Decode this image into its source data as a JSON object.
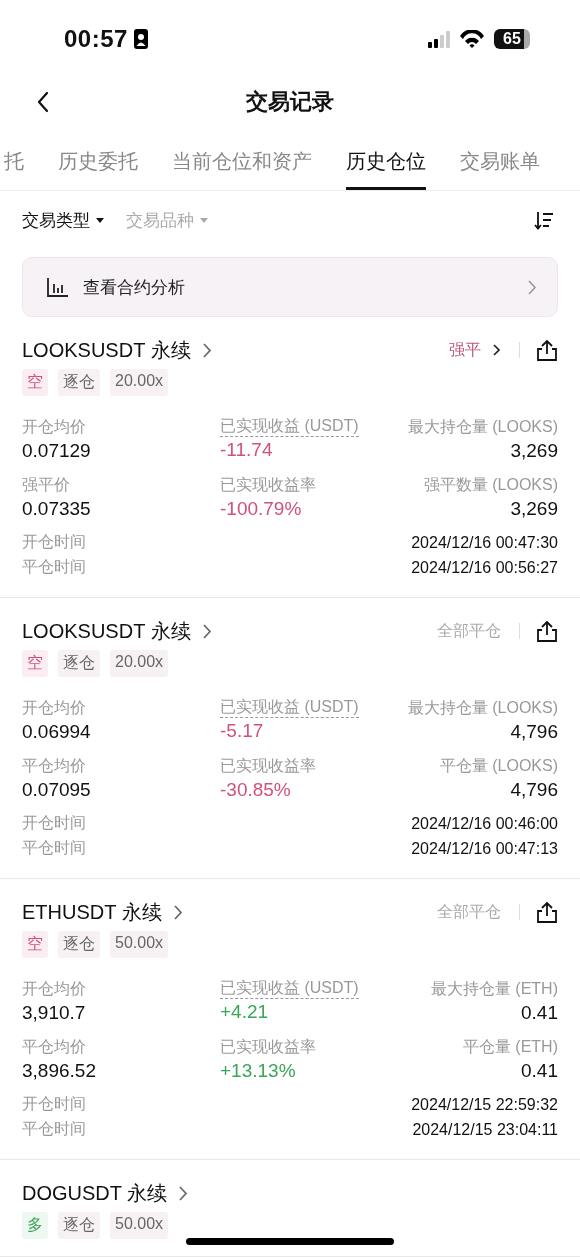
{
  "status_bar": {
    "time": "00:57",
    "battery": "65"
  },
  "nav": {
    "title": "交易记录"
  },
  "tabs": [
    {
      "label": "托",
      "selected": false
    },
    {
      "label": "历史委托",
      "selected": false
    },
    {
      "label": "当前仓位和资产",
      "selected": false
    },
    {
      "label": "历史仓位",
      "selected": true
    },
    {
      "label": "交易账单",
      "selected": false
    }
  ],
  "filters": [
    {
      "label": "交易类型",
      "active": true
    },
    {
      "label": "交易品种",
      "active": false
    }
  ],
  "banner": {
    "label": "查看合约分析"
  },
  "positions": [
    {
      "symbol": "LOOKSUSDT 永续",
      "status": {
        "text": "强平",
        "kind": "liquidated"
      },
      "tags": [
        {
          "text": "空",
          "kind": "short"
        },
        {
          "text": "逐仓",
          "kind": "plain"
        },
        {
          "text": "20.00x",
          "kind": "plain"
        }
      ],
      "stats": [
        {
          "label": "开仓均价",
          "value": "0.07129",
          "color": "#111111",
          "dashed": false
        },
        {
          "label": "已实现收益 (USDT)",
          "value": "-11.74",
          "color": "#d0507e",
          "dashed": true
        },
        {
          "label": "最大持仓量 (LOOKS)",
          "value": "3,269",
          "color": "#111111",
          "dashed": false
        },
        {
          "label": "强平价",
          "value": "0.07335",
          "color": "#111111",
          "dashed": false
        },
        {
          "label": "已实现收益率",
          "value": "-100.79%",
          "color": "#d0507e",
          "dashed": false
        },
        {
          "label": "强平数量 (LOOKS)",
          "value": "3,269",
          "color": "#111111",
          "dashed": false
        }
      ],
      "times": [
        {
          "label": "开仓时间",
          "value": "2024/12/16 00:47:30"
        },
        {
          "label": "平仓时间",
          "value": "2024/12/16 00:56:27"
        }
      ]
    },
    {
      "symbol": "LOOKSUSDT 永续",
      "status": {
        "text": "全部平仓",
        "kind": "closed"
      },
      "tags": [
        {
          "text": "空",
          "kind": "short"
        },
        {
          "text": "逐仓",
          "kind": "plain"
        },
        {
          "text": "20.00x",
          "kind": "plain"
        }
      ],
      "stats": [
        {
          "label": "开仓均价",
          "value": "0.06994",
          "color": "#111111",
          "dashed": false
        },
        {
          "label": "已实现收益 (USDT)",
          "value": "-5.17",
          "color": "#d0507e",
          "dashed": true
        },
        {
          "label": "最大持仓量 (LOOKS)",
          "value": "4,796",
          "color": "#111111",
          "dashed": false
        },
        {
          "label": "平仓均价",
          "value": "0.07095",
          "color": "#111111",
          "dashed": false
        },
        {
          "label": "已实现收益率",
          "value": "-30.85%",
          "color": "#d0507e",
          "dashed": false
        },
        {
          "label": "平仓量 (LOOKS)",
          "value": "4,796",
          "color": "#111111",
          "dashed": false
        }
      ],
      "times": [
        {
          "label": "开仓时间",
          "value": "2024/12/16 00:46:00"
        },
        {
          "label": "平仓时间",
          "value": "2024/12/16 00:47:13"
        }
      ]
    },
    {
      "symbol": "ETHUSDT 永续",
      "status": {
        "text": "全部平仓",
        "kind": "closed"
      },
      "tags": [
        {
          "text": "空",
          "kind": "short"
        },
        {
          "text": "逐仓",
          "kind": "plain"
        },
        {
          "text": "50.00x",
          "kind": "plain"
        }
      ],
      "stats": [
        {
          "label": "开仓均价",
          "value": "3,910.7",
          "color": "#111111",
          "dashed": false
        },
        {
          "label": "已实现收益 (USDT)",
          "value": "+4.21",
          "color": "#3aa658",
          "dashed": true
        },
        {
          "label": "最大持仓量 (ETH)",
          "value": "0.41",
          "color": "#111111",
          "dashed": false
        },
        {
          "label": "平仓均价",
          "value": "3,896.52",
          "color": "#111111",
          "dashed": false
        },
        {
          "label": "已实现收益率",
          "value": "+13.13%",
          "color": "#3aa658",
          "dashed": false
        },
        {
          "label": "平仓量 (ETH)",
          "value": "0.41",
          "color": "#111111",
          "dashed": false
        }
      ],
      "times": [
        {
          "label": "开仓时间",
          "value": "2024/12/15 22:59:32"
        },
        {
          "label": "平仓时间",
          "value": "2024/12/15 23:04:11"
        }
      ]
    },
    {
      "symbol": "DOGUSDT 永续",
      "tags": [
        {
          "text": "多",
          "kind": "long"
        },
        {
          "text": "逐仓",
          "kind": "plain"
        },
        {
          "text": "50.00x",
          "kind": "plain"
        }
      ]
    }
  ]
}
